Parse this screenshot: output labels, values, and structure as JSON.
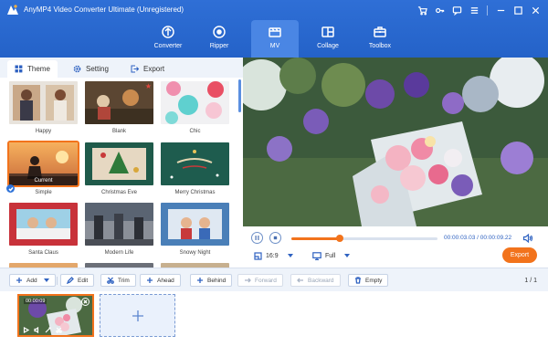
{
  "app": {
    "title": "AnyMP4 Video Converter Ultimate (Unregistered)"
  },
  "window_icons": [
    "cart-icon",
    "key-icon",
    "chat-icon",
    "menu-icon",
    "minimize-icon",
    "maximize-icon",
    "close-icon"
  ],
  "nav": [
    {
      "label": "Converter",
      "icon": "converter-icon"
    },
    {
      "label": "Ripper",
      "icon": "ripper-icon"
    },
    {
      "label": "MV",
      "icon": "mv-icon",
      "active": true
    },
    {
      "label": "Collage",
      "icon": "collage-icon"
    },
    {
      "label": "Toolbox",
      "icon": "toolbox-icon"
    }
  ],
  "tabs": [
    {
      "label": "Theme",
      "icon": "grid-icon",
      "active": true
    },
    {
      "label": "Setting",
      "icon": "gear-icon"
    },
    {
      "label": "Export",
      "icon": "export-icon"
    }
  ],
  "themes": [
    {
      "label": "Happy"
    },
    {
      "label": "Blank",
      "starred": true
    },
    {
      "label": "Chic"
    },
    {
      "label": "Simple",
      "selected": true,
      "badge": "Current"
    },
    {
      "label": "Christmas Eve"
    },
    {
      "label": "Merry Christmas"
    },
    {
      "label": "Santa Claus"
    },
    {
      "label": "Modern Life"
    },
    {
      "label": "Snowy Night"
    }
  ],
  "player": {
    "current_time": "00:00:03.03",
    "total_time": "00:00:09.22",
    "time_separator": "/",
    "progress": 0.33,
    "aspect_ratio": "16:9",
    "screen_mode": "Full",
    "export_label": "Export"
  },
  "toolbar": {
    "add": "Add",
    "edit": "Edit",
    "trim": "Trim",
    "ahead": "Ahead",
    "behind": "Behind",
    "forward": "Forward",
    "backward": "Backward",
    "empty": "Empty",
    "page_current": "1",
    "page_total": "1"
  },
  "clips": [
    {
      "duration": "00:00:09"
    }
  ],
  "colors": {
    "header_blue": "#2462c8",
    "accent_orange": "#f2731c",
    "panel_bg": "#eef3fa"
  }
}
